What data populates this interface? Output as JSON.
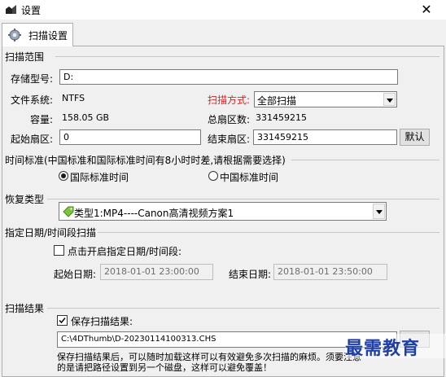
{
  "window": {
    "title": "设置"
  },
  "tabs": [
    {
      "label": "扫描设置"
    }
  ],
  "scan_range": {
    "title": "扫描范围",
    "storage_type_label": "存储型号:",
    "storage_type_value": "D:",
    "filesystem_label": "文件系统:",
    "filesystem_value": "NTFS",
    "scan_mode_label": "扫描方式:",
    "scan_mode_value": "全部扫描",
    "capacity_label": "容量:",
    "capacity_value": "158.05 GB",
    "total_sectors_label": "总扇区数:",
    "total_sectors_value": "331459215",
    "start_sector_label": "起始扇区:",
    "start_sector_value": "0",
    "end_sector_label": "结束扇区:",
    "end_sector_value": "331459215",
    "default_button": "默认"
  },
  "time_standard": {
    "title": "时间标准(中国标准和国际标准时间有8小时时差,请根据需要选择)",
    "option_international": "国际标准时间",
    "option_china": "中国标准时间",
    "selected": "international"
  },
  "recovery_type": {
    "title": "恢复类型",
    "selected_value": "类型1:MP4----Canon高清视频方案1",
    "icon": "tag-icon"
  },
  "date_range": {
    "title": "指定日期/时间段扫描",
    "enable_label": "点击开启指定日期/时间段:",
    "enabled": false,
    "start_label": "起始日期:",
    "start_value": "2018-01-01 23:00:00",
    "end_label": "结束日期:",
    "end_value": "2018-01-01 23:50:00"
  },
  "scan_result": {
    "title": "扫描结果",
    "save_label": "保存扫描结果:",
    "save_checked": true,
    "path_value": "C:\\4DThumb\\D-20230114100313.CHS",
    "note_line1": "保存扫描结果后，可以随时加载这样可以有效避免多次扫描的麻烦。须要注意",
    "note_line2": "的是请把路径设置到另一个磁盘，这样可以避免覆盖！"
  },
  "watermark": {
    "text": "最需教育"
  }
}
